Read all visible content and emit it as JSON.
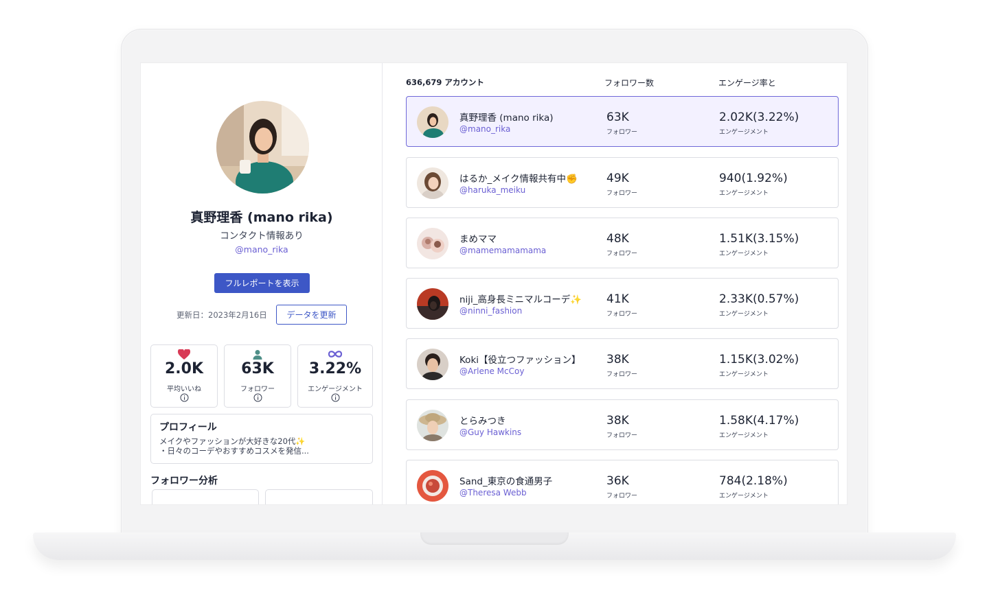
{
  "profile": {
    "name": "真野理香 (mano rika)",
    "contact": "コンタクト情報あり",
    "handle": "@mano_rika",
    "full_report_label": "フルレポートを表示",
    "updated": "更新日：2023年2月16日",
    "refresh_label": "データを更新",
    "stats": [
      {
        "value": "2.0K",
        "label": "平均いいね",
        "icon": "heart-icon"
      },
      {
        "value": "63K",
        "label": "フォロワー",
        "icon": "person-icon"
      },
      {
        "value": "3.22%",
        "label": "エンゲージメント",
        "icon": "infinity-icon"
      }
    ],
    "profile_title": "プロフィール",
    "bio_line1": "メイクやファッションが大好きな20代",
    "bio_line2": "・日々のコーデやおすすめコスメを発信...",
    "follower_analysis": "フォロワー分析"
  },
  "table": {
    "headers": {
      "accounts": "636,679 アカウント",
      "followers": "フォロワー数",
      "engagement": "エンゲージ率と"
    },
    "rows": [
      {
        "name": "真野理香 (mano rika)",
        "handle": "@mano_rika",
        "followers": "63K",
        "followers_label": "フォロワー",
        "engagement": "2.02K(3.22%)",
        "engagement_label": "エンゲージメント",
        "selected": true
      },
      {
        "name": "はるか_メイク情報共有中",
        "handle": "@haruka_meiku",
        "followers": "49K",
        "followers_label": "フォロワー",
        "engagement": "940(1.92%)",
        "engagement_label": "エンゲージメント"
      },
      {
        "name": "まめママ",
        "handle": "@mamemamamama",
        "followers": "48K",
        "followers_label": "フォロワー",
        "engagement": "1.51K(3.15%)",
        "engagement_label": "エンゲージメント"
      },
      {
        "name": "niji_高身長ミニマルコーデ",
        "handle": "@ninni_fashion",
        "followers": "41K",
        "followers_label": "フォロワー",
        "engagement": "2.33K(0.57%)",
        "engagement_label": "エンゲージメント"
      },
      {
        "name": "Koki【役立つファッション】",
        "handle": "@Arlene McCoy",
        "followers": "38K",
        "followers_label": "フォロワー",
        "engagement": "1.15K(3.02%)",
        "engagement_label": "エンゲージメント"
      },
      {
        "name": "とらみつき",
        "handle": "@Guy Hawkins",
        "followers": "38K",
        "followers_label": "フォロワー",
        "engagement": "1.58K(4.17%)",
        "engagement_label": "エンゲージメント"
      },
      {
        "name": "Sand_東京の食通男子",
        "handle": "@Theresa Webb",
        "followers": "36K",
        "followers_label": "フォロワー",
        "engagement": "784(2.18%)",
        "engagement_label": "エンゲージメント"
      }
    ]
  },
  "colors": {
    "accent": "#3d57c6",
    "handle": "#6a5fd3",
    "selected_bg": "#f3f1ff",
    "heart": "#d83a56"
  }
}
